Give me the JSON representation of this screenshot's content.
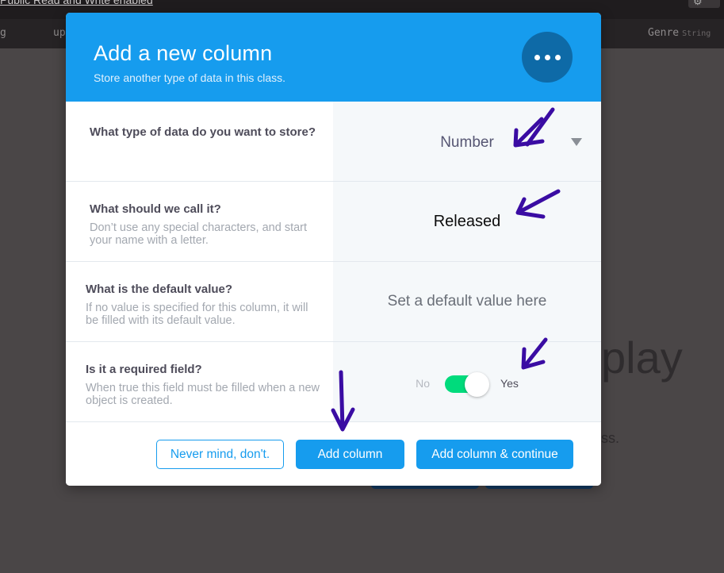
{
  "background": {
    "top_link": "Public Read and Write enabled",
    "columns": [
      {
        "name": "g",
        "type": ""
      },
      {
        "name": "up",
        "type": ""
      },
      {
        "name": "Genre",
        "type": "String"
      }
    ],
    "big_text": "play",
    "small_text": "ss."
  },
  "modal": {
    "title": "Add a new column",
    "subtitle": "Store another type of data in this class.",
    "more_icon": "more-horizontal-icon",
    "rows": {
      "type": {
        "label": "What type of data do you want to store?",
        "value": "Number"
      },
      "name": {
        "label": "What should we call it?",
        "description": "Don’t use any special characters, and start your name with a letter.",
        "value": "Released"
      },
      "default": {
        "label": "What is the default value?",
        "description": "If no value is specified for this column, it will be filled with its default value.",
        "value": "",
        "placeholder": "Set a default value here"
      },
      "required": {
        "label": "Is it a required field?",
        "description": "When true this field must be filled when a new object is created.",
        "no_label": "No",
        "yes_label": "Yes",
        "checked": true
      }
    },
    "footer": {
      "cancel_label": "Never mind, don't.",
      "add_label": "Add column",
      "add_continue_label": "Add column & continue"
    }
  },
  "colors": {
    "header_blue": "#169cee",
    "more_button": "#0e6aa7",
    "toggle_on": "#00db7c",
    "annotation_ink": "#3a0ca3"
  }
}
